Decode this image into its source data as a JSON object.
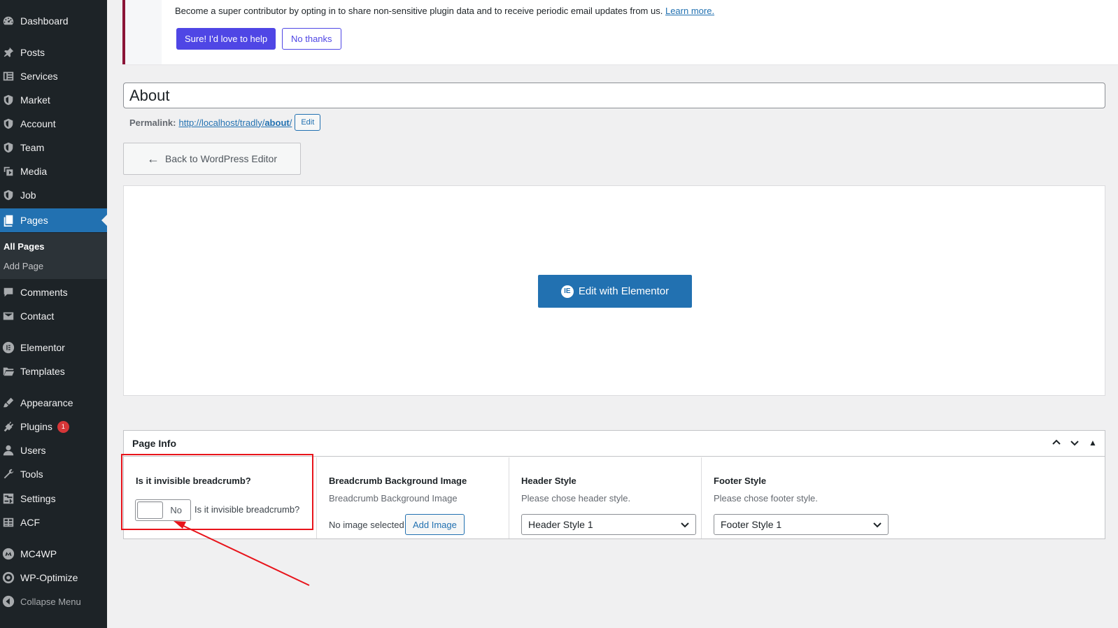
{
  "sidebar": {
    "items": [
      {
        "label": "Dashboard",
        "icon": "dashboard-icon"
      },
      {
        "label": "Posts",
        "icon": "pin-icon"
      },
      {
        "label": "Services",
        "icon": "services-icon"
      },
      {
        "label": "Market",
        "icon": "shield-icon"
      },
      {
        "label": "Account",
        "icon": "shield-icon"
      },
      {
        "label": "Team",
        "icon": "shield-icon"
      },
      {
        "label": "Media",
        "icon": "media-icon"
      },
      {
        "label": "Job",
        "icon": "shield-icon"
      },
      {
        "label": "Pages",
        "icon": "pages-icon",
        "current": true
      },
      {
        "label": "Comments",
        "icon": "comment-icon"
      },
      {
        "label": "Contact",
        "icon": "mail-icon"
      },
      {
        "label": "Elementor",
        "icon": "elementor-icon"
      },
      {
        "label": "Templates",
        "icon": "folder-icon"
      },
      {
        "label": "Appearance",
        "icon": "brush-icon"
      },
      {
        "label": "Plugins",
        "icon": "plugin-icon",
        "badge": "1"
      },
      {
        "label": "Users",
        "icon": "user-icon"
      },
      {
        "label": "Tools",
        "icon": "wrench-icon"
      },
      {
        "label": "Settings",
        "icon": "settings-icon"
      },
      {
        "label": "ACF",
        "icon": "table-icon"
      },
      {
        "label": "MC4WP",
        "icon": "mc4wp-icon"
      },
      {
        "label": "WP-Optimize",
        "icon": "optimize-icon"
      }
    ],
    "submenu": [
      {
        "label": "All Pages",
        "active": true
      },
      {
        "label": "Add Page"
      }
    ],
    "collapse_label": "Collapse Menu"
  },
  "notice": {
    "text": "Become a super contributor by opting in to share non-sensitive plugin data and to receive periodic email updates from us.",
    "link": "Learn more.",
    "accept_label": "Sure! I'd love to help",
    "decline_label": "No thanks"
  },
  "editor": {
    "title": "About",
    "permalink_label": "Permalink:",
    "permalink_base": "http://localhost/tradly/",
    "permalink_slug": "about",
    "permalink_end": "/",
    "edit_label": "Edit",
    "back_label": "Back to WordPress Editor",
    "elementor_label": "Edit with Elementor",
    "elementor_logo": "IE"
  },
  "page_info": {
    "title": "Page Info",
    "breadcrumb": {
      "label": "Is it invisible breadcrumb?",
      "toggle_value": "No",
      "toggle_desc": "Is it invisible breadcrumb?"
    },
    "bg_image": {
      "label": "Breadcrumb Background Image",
      "desc": "Breadcrumb Background Image",
      "status": "No image selected",
      "button": "Add Image"
    },
    "header_style": {
      "label": "Header Style",
      "desc": "Please chose header style.",
      "value": "Header Style 1"
    },
    "footer_style": {
      "label": "Footer Style",
      "desc": "Please chose footer style.",
      "value": "Footer Style 1"
    }
  },
  "colors": {
    "sidebar_bg": "#1d2327",
    "accent": "#2271b1",
    "annotation": "#e8141b",
    "notice_button": "#4f46e5"
  }
}
